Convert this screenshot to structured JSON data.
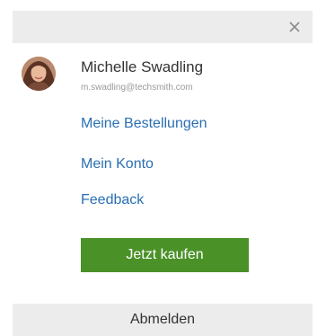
{
  "header": {
    "close_icon": "close-icon"
  },
  "user": {
    "avatar_icon": "avatar",
    "name": "Michelle Swadling",
    "email": "m.swadling@techsmith.com"
  },
  "menu": {
    "items": [
      {
        "label": "Meine Bestellungen"
      },
      {
        "label": "Mein Konto"
      },
      {
        "label": "Feedback"
      }
    ]
  },
  "actions": {
    "buy_label": "Jetzt kaufen",
    "logout_label": "Abmelden"
  },
  "colors": {
    "link": "#2a6fb3",
    "buy_button": "#4a9128",
    "bar_background": "#ececec"
  }
}
